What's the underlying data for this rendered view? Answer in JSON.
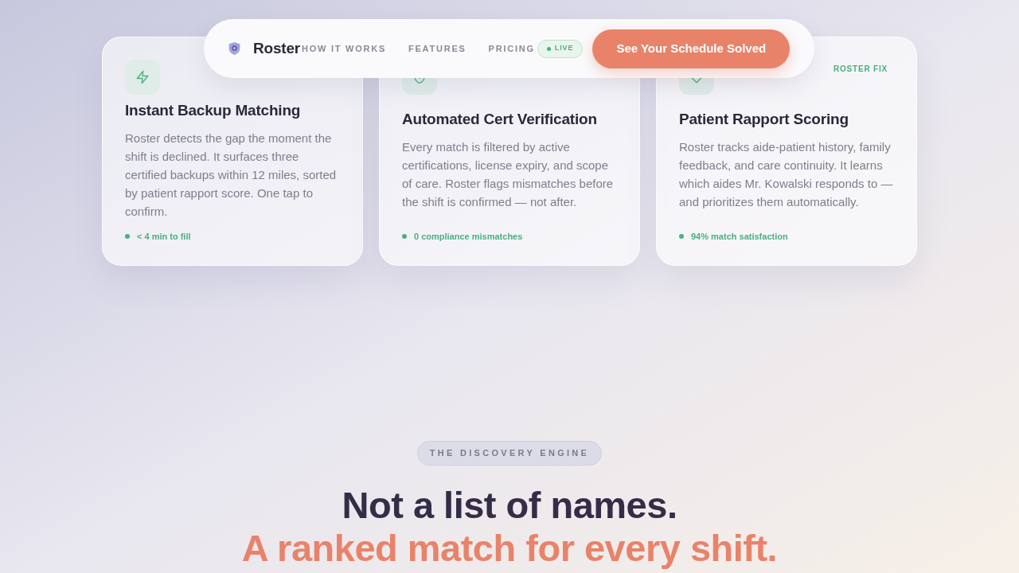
{
  "nav": {
    "brand": "Roster",
    "links": [
      "HOW IT WORKS",
      "FEATURES",
      "PRICING"
    ],
    "badge": "LIVE",
    "cta": "See Your Schedule Solved"
  },
  "cards": [
    {
      "title": "Instant Backup Matching",
      "body": "Roster detects the gap the moment the shift is declined. It surfaces three certified backups within 12 miles, sorted by patient rapport score. One tap to confirm.",
      "stat": "< 4 min to fill"
    },
    {
      "title": "Automated Cert Verification",
      "body": "Every match is filtered by active certifications, license expiry, and scope of care. Roster flags mismatches before the shift is confirmed — not after.",
      "stat": "0 compliance mismatches"
    },
    {
      "label": "ROSTER FIX",
      "title": "Patient Rapport Scoring",
      "body": "Roster tracks aide-patient history, family feedback, and care continuity. It learns which aides Mr. Kowalski responds to — and prioritizes them automatically.",
      "stat": "94% match satisfaction"
    }
  ],
  "section": {
    "eyebrow": "THE DISCOVERY ENGINE",
    "heading": "Not a list of names.",
    "heading_accent": "A ranked match for every shift."
  }
}
